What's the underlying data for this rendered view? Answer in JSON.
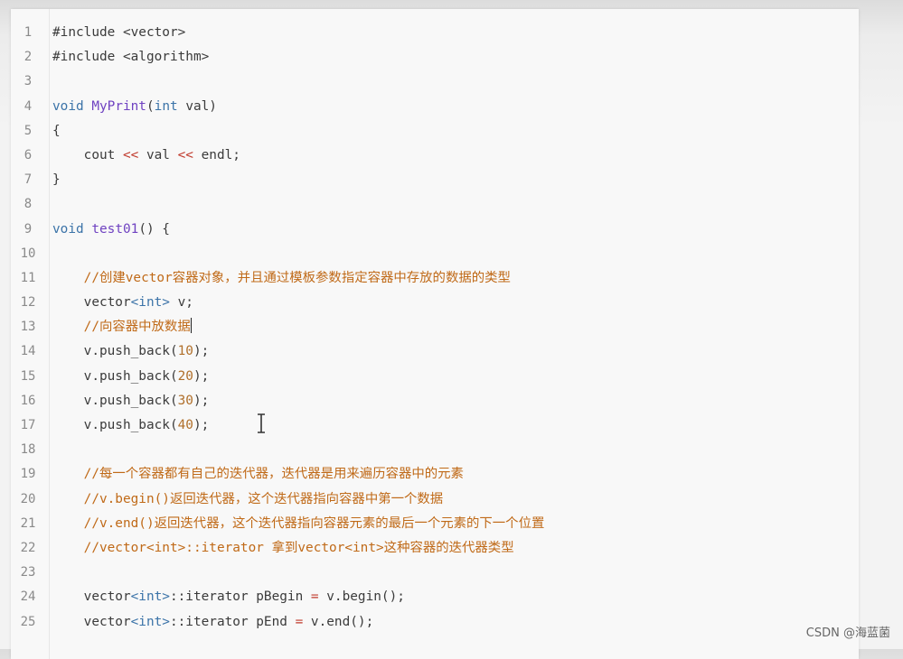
{
  "editor": {
    "lines": [
      {
        "n": "1",
        "tokens": [
          {
            "t": "#include <vector>",
            "c": "pl"
          }
        ]
      },
      {
        "n": "2",
        "tokens": [
          {
            "t": "#include <algorithm>",
            "c": "pl"
          }
        ]
      },
      {
        "n": "3",
        "tokens": []
      },
      {
        "n": "4",
        "tokens": [
          {
            "t": "void ",
            "c": "kw"
          },
          {
            "t": "MyPrint",
            "c": "fn"
          },
          {
            "t": "(",
            "c": "pl"
          },
          {
            "t": "int",
            "c": "kw"
          },
          {
            "t": " val)",
            "c": "pl"
          }
        ]
      },
      {
        "n": "5",
        "tokens": [
          {
            "t": "{",
            "c": "pl"
          }
        ]
      },
      {
        "n": "6",
        "tokens": [
          {
            "t": "    cout ",
            "c": "pl"
          },
          {
            "t": "<<",
            "c": "op"
          },
          {
            "t": " val ",
            "c": "pl"
          },
          {
            "t": "<<",
            "c": "op"
          },
          {
            "t": " endl;",
            "c": "pl"
          }
        ]
      },
      {
        "n": "7",
        "tokens": [
          {
            "t": "}",
            "c": "pl"
          }
        ]
      },
      {
        "n": "8",
        "tokens": []
      },
      {
        "n": "9",
        "tokens": [
          {
            "t": "void ",
            "c": "kw"
          },
          {
            "t": "test01",
            "c": "fn"
          },
          {
            "t": "() {",
            "c": "pl"
          }
        ]
      },
      {
        "n": "10",
        "tokens": []
      },
      {
        "n": "11",
        "tokens": [
          {
            "t": "    //创建vector容器对象，并且通过模板参数指定容器中存放的数据的类型",
            "c": "cm"
          }
        ]
      },
      {
        "n": "12",
        "tokens": [
          {
            "t": "    vector",
            "c": "pl"
          },
          {
            "t": "<int>",
            "c": "kw"
          },
          {
            "t": " v;",
            "c": "pl"
          }
        ]
      },
      {
        "n": "13",
        "tokens": [
          {
            "t": "    //向容器中放数据",
            "c": "cm"
          }
        ],
        "cursor": true
      },
      {
        "n": "14",
        "tokens": [
          {
            "t": "    v.push_back(",
            "c": "pl"
          },
          {
            "t": "10",
            "c": "num"
          },
          {
            "t": ");",
            "c": "pl"
          }
        ]
      },
      {
        "n": "15",
        "tokens": [
          {
            "t": "    v.push_back(",
            "c": "pl"
          },
          {
            "t": "20",
            "c": "num"
          },
          {
            "t": ");",
            "c": "pl"
          }
        ]
      },
      {
        "n": "16",
        "tokens": [
          {
            "t": "    v.push_back(",
            "c": "pl"
          },
          {
            "t": "30",
            "c": "num"
          },
          {
            "t": ");",
            "c": "pl"
          }
        ]
      },
      {
        "n": "17",
        "tokens": [
          {
            "t": "    v.push_back(",
            "c": "pl"
          },
          {
            "t": "40",
            "c": "num"
          },
          {
            "t": ");",
            "c": "pl"
          }
        ]
      },
      {
        "n": "18",
        "tokens": []
      },
      {
        "n": "19",
        "tokens": [
          {
            "t": "    //每一个容器都有自己的迭代器，迭代器是用来遍历容器中的元素",
            "c": "cm"
          }
        ]
      },
      {
        "n": "20",
        "tokens": [
          {
            "t": "    //v.begin()返回迭代器，这个迭代器指向容器中第一个数据",
            "c": "cm"
          }
        ]
      },
      {
        "n": "21",
        "tokens": [
          {
            "t": "    //v.end()返回迭代器，这个迭代器指向容器元素的最后一个元素的下一个位置",
            "c": "cm"
          }
        ]
      },
      {
        "n": "22",
        "tokens": [
          {
            "t": "    //vector<int>::iterator 拿到vector<int>这种容器的迭代器类型",
            "c": "cm"
          }
        ]
      },
      {
        "n": "23",
        "tokens": []
      },
      {
        "n": "24",
        "tokens": [
          {
            "t": "    vector",
            "c": "pl"
          },
          {
            "t": "<int>",
            "c": "kw"
          },
          {
            "t": "::iterator pBegin ",
            "c": "pl"
          },
          {
            "t": "=",
            "c": "op"
          },
          {
            "t": " v.begin();",
            "c": "pl"
          }
        ]
      },
      {
        "n": "25",
        "tokens": [
          {
            "t": "    vector",
            "c": "pl"
          },
          {
            "t": "<int>",
            "c": "kw"
          },
          {
            "t": "::iterator pEnd ",
            "c": "pl"
          },
          {
            "t": "=",
            "c": "op"
          },
          {
            "t": " v.end();",
            "c": "pl"
          }
        ]
      }
    ]
  },
  "watermark": "CSDN @海蓝菌"
}
